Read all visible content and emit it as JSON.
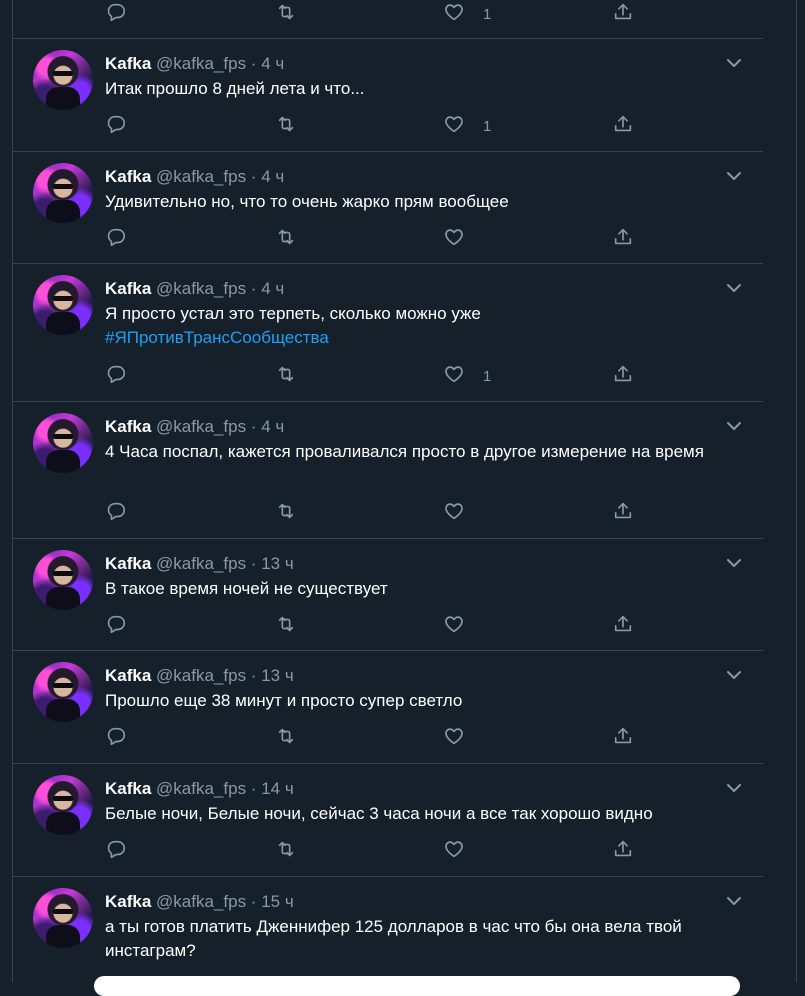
{
  "icons": {
    "reply": "reply-icon",
    "retweet": "retweet-icon",
    "like": "heart-icon",
    "share": "share-icon",
    "more": "chevron-down-icon"
  },
  "colors": {
    "background": "#15202b",
    "border": "#38444d",
    "secondary_text": "#8899a6",
    "link": "#1da1f2"
  },
  "top_partial": {
    "like_count": "1"
  },
  "tweets": [
    {
      "name": "Kafka",
      "handle": "@kafka_fps",
      "time": "4 ч",
      "text": "Итак прошло 8 дней лета и что...",
      "hashtag": "",
      "like_count": "1"
    },
    {
      "name": "Kafka",
      "handle": "@kafka_fps",
      "time": "4 ч",
      "text": "Удивительно но, что то очень жарко прям вообщее",
      "hashtag": "",
      "like_count": ""
    },
    {
      "name": "Kafka",
      "handle": "@kafka_fps",
      "time": "4 ч",
      "text": "Я просто устал это терпеть, сколько можно уже",
      "hashtag": "#ЯПротивТрансСообщества",
      "like_count": "1"
    },
    {
      "name": "Kafka",
      "handle": "@kafka_fps",
      "time": "4 ч",
      "text": "4 Часа поспал, кажется проваливался просто в другое измерение на время",
      "hashtag": "",
      "like_count": ""
    },
    {
      "name": "Kafka",
      "handle": "@kafka_fps",
      "time": "13 ч",
      "text": "В такое время ночей не существует",
      "hashtag": "",
      "like_count": ""
    },
    {
      "name": "Kafka",
      "handle": "@kafka_fps",
      "time": "13 ч",
      "text": "Прошло еще 38 минут и просто супер светло",
      "hashtag": "",
      "like_count": ""
    },
    {
      "name": "Kafka",
      "handle": "@kafka_fps",
      "time": "14 ч",
      "text": "Белые ночи, Белые ночи, сейчас 3 часа ночи а все так хорошо видно",
      "hashtag": "",
      "like_count": ""
    },
    {
      "name": "Kafka",
      "handle": "@kafka_fps",
      "time": "15 ч",
      "text": "а ты готов платить Дженнифер 125 долларов в час что бы она вела твой инстаграм?",
      "hashtag": "",
      "like_count": ""
    }
  ]
}
